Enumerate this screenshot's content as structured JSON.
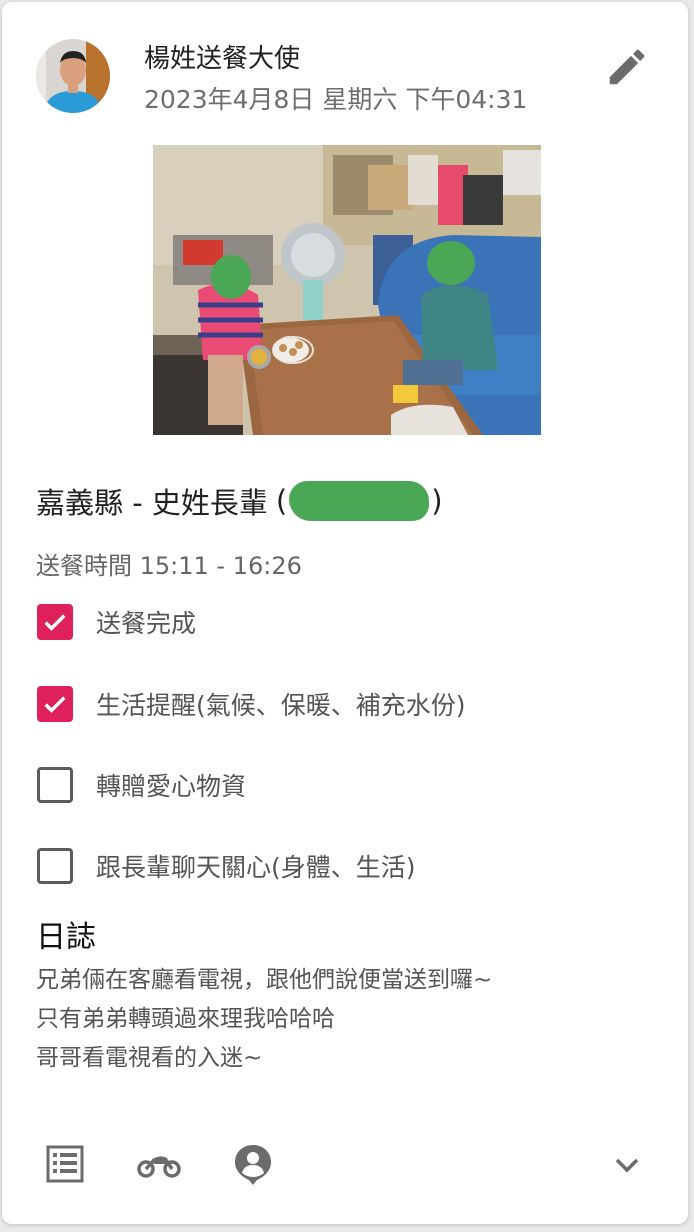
{
  "post": {
    "author_name": "楊姓送餐大使",
    "datetime": "2023年4月8日 星期六 下午04:31"
  },
  "recipient": {
    "title_prefix": "嘉義縣 - 史姓長輩",
    "paren_open": "(",
    "paren_close": ")"
  },
  "delivery_time": "送餐時間 15:11 - 16:26",
  "checklist": [
    {
      "label": "送餐完成",
      "checked": true
    },
    {
      "label": "生活提醒(氣候、保暖、補充水份)",
      "checked": true
    },
    {
      "label": "轉贈愛心物資",
      "checked": false
    },
    {
      "label": "跟長輩聊天關心(身體、生活)",
      "checked": false
    }
  ],
  "log": {
    "title": "日誌",
    "lines": [
      "兄弟倆在客廳看電視，跟他們說便當送到囉~",
      "只有弟弟轉頭過來理我哈哈哈",
      "哥哥看電視看的入迷~"
    ]
  },
  "icons": {
    "edit": "pencil-icon",
    "list": "list-icon",
    "scooter": "motorcycle-icon",
    "profile": "account-pin-icon",
    "expand": "chevron-down-icon"
  },
  "colors": {
    "checkbox_checked": "#e0205a",
    "icon_gray": "#6b6b6b",
    "redaction": "#4aa755"
  }
}
